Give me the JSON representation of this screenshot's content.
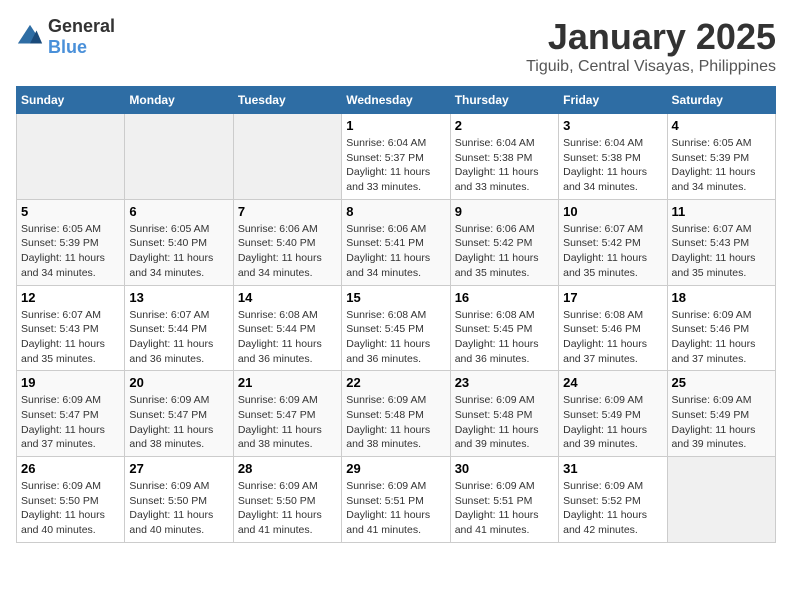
{
  "header": {
    "logo_general": "General",
    "logo_blue": "Blue",
    "month_year": "January 2025",
    "location": "Tiguib, Central Visayas, Philippines"
  },
  "weekdays": [
    "Sunday",
    "Monday",
    "Tuesday",
    "Wednesday",
    "Thursday",
    "Friday",
    "Saturday"
  ],
  "weeks": [
    [
      null,
      null,
      null,
      {
        "day": 1,
        "sunrise": "6:04 AM",
        "sunset": "5:37 PM",
        "daylight": "11 hours and 33 minutes."
      },
      {
        "day": 2,
        "sunrise": "6:04 AM",
        "sunset": "5:38 PM",
        "daylight": "11 hours and 33 minutes."
      },
      {
        "day": 3,
        "sunrise": "6:04 AM",
        "sunset": "5:38 PM",
        "daylight": "11 hours and 34 minutes."
      },
      {
        "day": 4,
        "sunrise": "6:05 AM",
        "sunset": "5:39 PM",
        "daylight": "11 hours and 34 minutes."
      }
    ],
    [
      {
        "day": 5,
        "sunrise": "6:05 AM",
        "sunset": "5:39 PM",
        "daylight": "11 hours and 34 minutes."
      },
      {
        "day": 6,
        "sunrise": "6:05 AM",
        "sunset": "5:40 PM",
        "daylight": "11 hours and 34 minutes."
      },
      {
        "day": 7,
        "sunrise": "6:06 AM",
        "sunset": "5:40 PM",
        "daylight": "11 hours and 34 minutes."
      },
      {
        "day": 8,
        "sunrise": "6:06 AM",
        "sunset": "5:41 PM",
        "daylight": "11 hours and 34 minutes."
      },
      {
        "day": 9,
        "sunrise": "6:06 AM",
        "sunset": "5:42 PM",
        "daylight": "11 hours and 35 minutes."
      },
      {
        "day": 10,
        "sunrise": "6:07 AM",
        "sunset": "5:42 PM",
        "daylight": "11 hours and 35 minutes."
      },
      {
        "day": 11,
        "sunrise": "6:07 AM",
        "sunset": "5:43 PM",
        "daylight": "11 hours and 35 minutes."
      }
    ],
    [
      {
        "day": 12,
        "sunrise": "6:07 AM",
        "sunset": "5:43 PM",
        "daylight": "11 hours and 35 minutes."
      },
      {
        "day": 13,
        "sunrise": "6:07 AM",
        "sunset": "5:44 PM",
        "daylight": "11 hours and 36 minutes."
      },
      {
        "day": 14,
        "sunrise": "6:08 AM",
        "sunset": "5:44 PM",
        "daylight": "11 hours and 36 minutes."
      },
      {
        "day": 15,
        "sunrise": "6:08 AM",
        "sunset": "5:45 PM",
        "daylight": "11 hours and 36 minutes."
      },
      {
        "day": 16,
        "sunrise": "6:08 AM",
        "sunset": "5:45 PM",
        "daylight": "11 hours and 36 minutes."
      },
      {
        "day": 17,
        "sunrise": "6:08 AM",
        "sunset": "5:46 PM",
        "daylight": "11 hours and 37 minutes."
      },
      {
        "day": 18,
        "sunrise": "6:09 AM",
        "sunset": "5:46 PM",
        "daylight": "11 hours and 37 minutes."
      }
    ],
    [
      {
        "day": 19,
        "sunrise": "6:09 AM",
        "sunset": "5:47 PM",
        "daylight": "11 hours and 37 minutes."
      },
      {
        "day": 20,
        "sunrise": "6:09 AM",
        "sunset": "5:47 PM",
        "daylight": "11 hours and 38 minutes."
      },
      {
        "day": 21,
        "sunrise": "6:09 AM",
        "sunset": "5:47 PM",
        "daylight": "11 hours and 38 minutes."
      },
      {
        "day": 22,
        "sunrise": "6:09 AM",
        "sunset": "5:48 PM",
        "daylight": "11 hours and 38 minutes."
      },
      {
        "day": 23,
        "sunrise": "6:09 AM",
        "sunset": "5:48 PM",
        "daylight": "11 hours and 39 minutes."
      },
      {
        "day": 24,
        "sunrise": "6:09 AM",
        "sunset": "5:49 PM",
        "daylight": "11 hours and 39 minutes."
      },
      {
        "day": 25,
        "sunrise": "6:09 AM",
        "sunset": "5:49 PM",
        "daylight": "11 hours and 39 minutes."
      }
    ],
    [
      {
        "day": 26,
        "sunrise": "6:09 AM",
        "sunset": "5:50 PM",
        "daylight": "11 hours and 40 minutes."
      },
      {
        "day": 27,
        "sunrise": "6:09 AM",
        "sunset": "5:50 PM",
        "daylight": "11 hours and 40 minutes."
      },
      {
        "day": 28,
        "sunrise": "6:09 AM",
        "sunset": "5:50 PM",
        "daylight": "11 hours and 41 minutes."
      },
      {
        "day": 29,
        "sunrise": "6:09 AM",
        "sunset": "5:51 PM",
        "daylight": "11 hours and 41 minutes."
      },
      {
        "day": 30,
        "sunrise": "6:09 AM",
        "sunset": "5:51 PM",
        "daylight": "11 hours and 41 minutes."
      },
      {
        "day": 31,
        "sunrise": "6:09 AM",
        "sunset": "5:52 PM",
        "daylight": "11 hours and 42 minutes."
      },
      null
    ]
  ],
  "labels": {
    "sunrise": "Sunrise:",
    "sunset": "Sunset:",
    "daylight": "Daylight:"
  }
}
